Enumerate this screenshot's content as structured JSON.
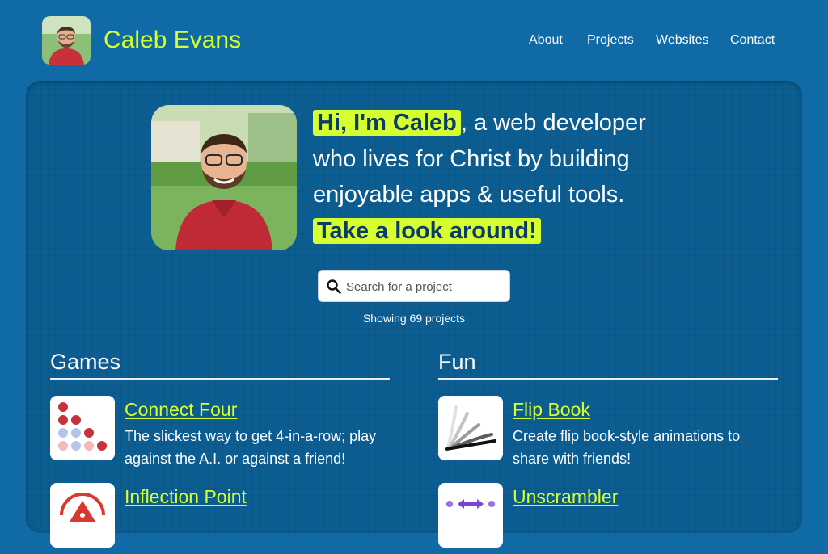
{
  "header": {
    "site_title": "Caleb Evans",
    "nav": [
      "About",
      "Projects",
      "Websites",
      "Contact"
    ]
  },
  "hero": {
    "highlight_1": "Hi, I'm Caleb",
    "text_1": ", a web developer who lives for Christ by building enjoyable apps & useful tools.",
    "highlight_2": "Take a look around!"
  },
  "search": {
    "placeholder": "Search for a project",
    "value": ""
  },
  "showing_text": "Showing 69 projects",
  "sections": [
    {
      "title": "Games",
      "projects": [
        {
          "name": "Connect Four",
          "description": "The slickest way to get 4-in-a-row; play against the A.I. or against a friend!",
          "icon": "connect-four-icon"
        },
        {
          "name": "Inflection Point",
          "description": "",
          "icon": "inflection-point-icon"
        }
      ]
    },
    {
      "title": "Fun",
      "projects": [
        {
          "name": "Flip Book",
          "description": "Create flip book-style animations to share with friends!",
          "icon": "flip-book-icon"
        },
        {
          "name": "Unscrambler",
          "description": "",
          "icon": "unscrambler-icon"
        }
      ]
    }
  ],
  "colors": {
    "background": "#0f6aa6",
    "accent": "#d7ff2f",
    "highlight_text": "#0b3c67"
  }
}
